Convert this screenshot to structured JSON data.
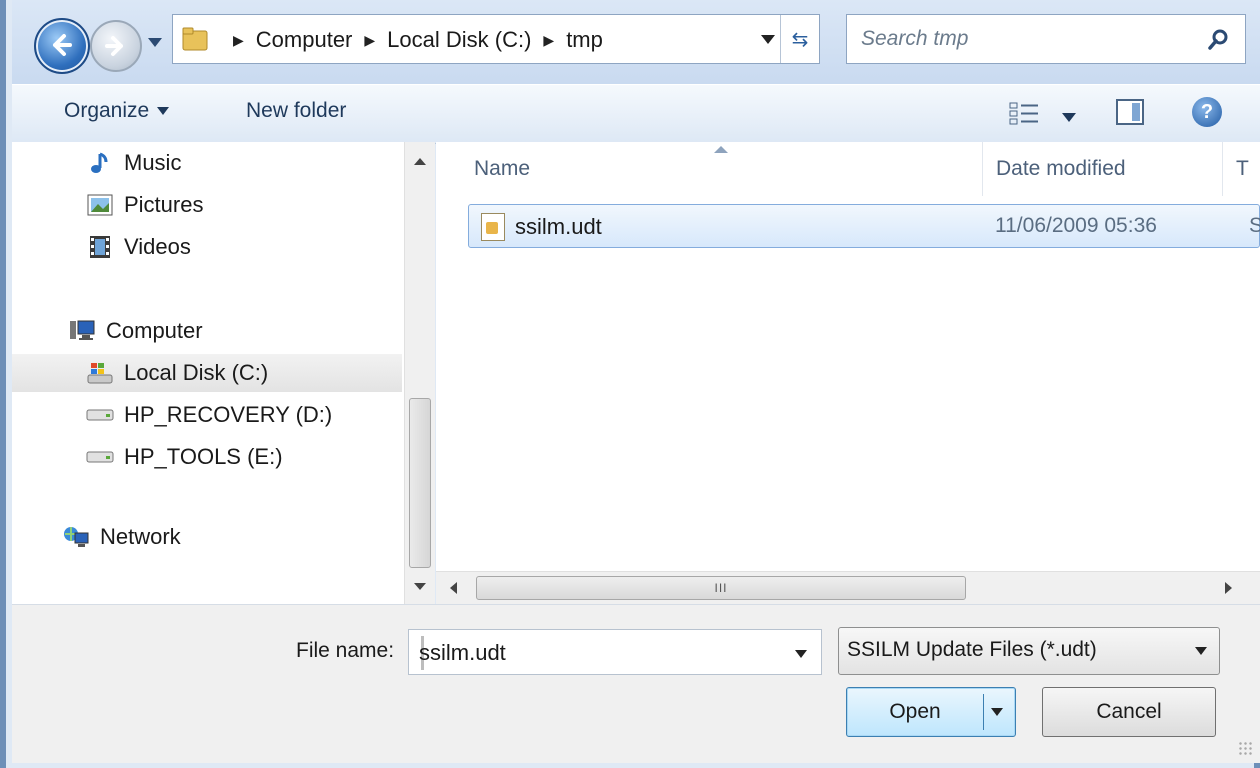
{
  "address": {
    "crumbs": [
      "Computer",
      "Local Disk (C:)",
      "tmp"
    ],
    "search_placeholder": "Search tmp"
  },
  "toolbar": {
    "organize": "Organize",
    "new_folder": "New folder"
  },
  "navigation": {
    "items": [
      {
        "label": "Music",
        "icon": "music-note-icon"
      },
      {
        "label": "Pictures",
        "icon": "pictures-icon"
      },
      {
        "label": "Videos",
        "icon": "film-strip-icon"
      },
      {
        "label": "Computer",
        "icon": "computer-icon"
      },
      {
        "label": "Local Disk (C:)",
        "icon": "windows-drive-icon",
        "selected": true
      },
      {
        "label": "HP_RECOVERY (D:)",
        "icon": "drive-icon"
      },
      {
        "label": "HP_TOOLS (E:)",
        "icon": "drive-icon"
      },
      {
        "label": "Network",
        "icon": "network-icon"
      }
    ]
  },
  "file_list": {
    "columns": [
      "Name",
      "Date modified",
      "T"
    ],
    "rows": [
      {
        "name": "ssilm.udt",
        "date_modified": "11/06/2009 05:36",
        "type": "S"
      }
    ],
    "scroll_glyph": "III"
  },
  "footer": {
    "file_name_label": "File name:",
    "file_name_value": "ssilm.udt",
    "file_type_value": "SSILM Update Files (*.udt)",
    "open_label": "Open",
    "cancel_label": "Cancel"
  }
}
